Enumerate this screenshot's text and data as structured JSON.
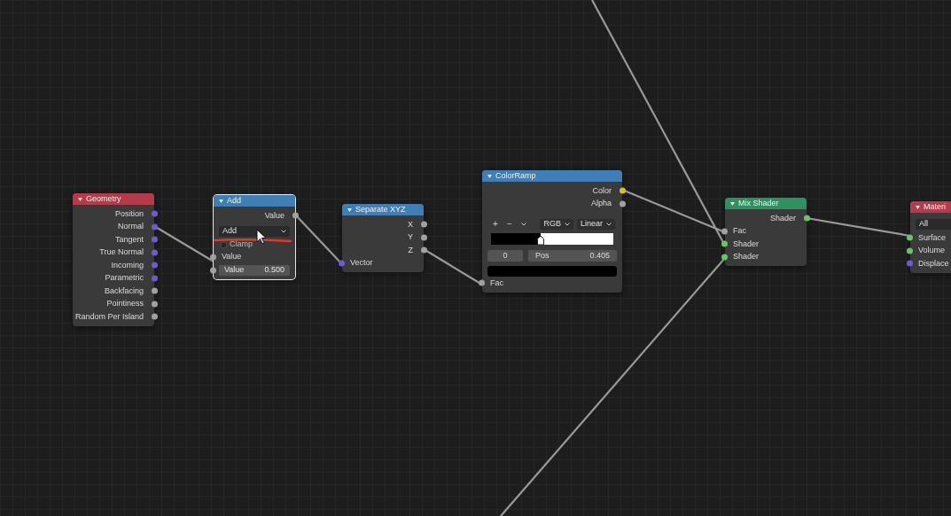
{
  "nodes": [
    {
      "title": "Geometry",
      "color": "#b53a4a",
      "selected": false,
      "rows": [
        {
          "kind": "output",
          "label": "Position",
          "color": "#6b5bd6"
        },
        {
          "kind": "output",
          "label": "Normal",
          "color": "#6b5bd6"
        },
        {
          "kind": "output",
          "label": "Tangent",
          "color": "#6b5bd6"
        },
        {
          "kind": "output",
          "label": "True Normal",
          "color": "#6b5bd6"
        },
        {
          "kind": "output",
          "label": "Incoming",
          "color": "#6b5bd6"
        },
        {
          "kind": "output",
          "label": "Parametric",
          "color": "#6b5bd6"
        },
        {
          "kind": "output",
          "label": "Backfacing",
          "color": "#a1a1a1"
        },
        {
          "kind": "output",
          "label": "Pointiness",
          "color": "#a1a1a1"
        },
        {
          "kind": "output",
          "label": "Random Per Island",
          "color": "#a1a1a1"
        }
      ]
    },
    {
      "title": "Add",
      "color": "#3f7fb5",
      "selected": true,
      "rows": [
        {
          "kind": "output",
          "label": "Value",
          "color": "#a1a1a1"
        },
        {
          "kind": "dropdown",
          "label": "Add"
        },
        {
          "kind": "checkbox",
          "label": "Clamp",
          "checked": false
        },
        {
          "kind": "input",
          "label": "Value",
          "color": "#a1a1a1"
        },
        {
          "kind": "field",
          "label": "Value",
          "value": "0.500",
          "color": "#a1a1a1"
        }
      ]
    },
    {
      "title": "Separate XYZ",
      "color": "#3f7fb5",
      "selected": false,
      "rows": [
        {
          "kind": "output",
          "label": "X",
          "color": "#a1a1a1"
        },
        {
          "kind": "output",
          "label": "Y",
          "color": "#a1a1a1"
        },
        {
          "kind": "output",
          "label": "Z",
          "color": "#a1a1a1"
        },
        {
          "kind": "input",
          "label": "Vector",
          "color": "#6b5bd6"
        }
      ]
    },
    {
      "title": "ColorRamp",
      "color": "#3f7fb5",
      "selected": false,
      "rows": [
        {
          "kind": "output",
          "label": "Color",
          "color": "#c7c729"
        },
        {
          "kind": "output",
          "label": "Alpha",
          "color": "#a1a1a1"
        },
        {
          "kind": "ramp_toolbar",
          "buttons": [
            "+",
            "−"
          ],
          "dropdowns": [
            "RGB",
            "Linear"
          ]
        },
        {
          "kind": "ramp",
          "level": 0.405
        },
        {
          "kind": "ramp_fields",
          "index": "0",
          "label": "Pos",
          "value": "0.405"
        },
        {
          "kind": "swatch",
          "color": "#000000"
        },
        {
          "kind": "input",
          "label": "Fac",
          "color": "#a1a1a1"
        }
      ]
    },
    {
      "title": "Mix Shader",
      "color": "#2f9060",
      "selected": false,
      "rows": [
        {
          "kind": "output",
          "label": "Shader",
          "color": "#63c763"
        },
        {
          "kind": "input",
          "label": "Fac",
          "color": "#a1a1a1"
        },
        {
          "kind": "input",
          "label": "Shader",
          "color": "#63c763"
        },
        {
          "kind": "input",
          "label": "Shader",
          "color": "#63c763"
        }
      ]
    },
    {
      "title": "Materi",
      "color": "#b53a4a",
      "selected": false,
      "rows": [
        {
          "kind": "dropdown",
          "label": "All"
        },
        {
          "kind": "input",
          "label": "Surface",
          "color": "#63c763"
        },
        {
          "kind": "input",
          "label": "Volume",
          "color": "#63c763"
        },
        {
          "kind": "input",
          "label": "Displace",
          "color": "#6b5bd6"
        }
      ]
    }
  ]
}
